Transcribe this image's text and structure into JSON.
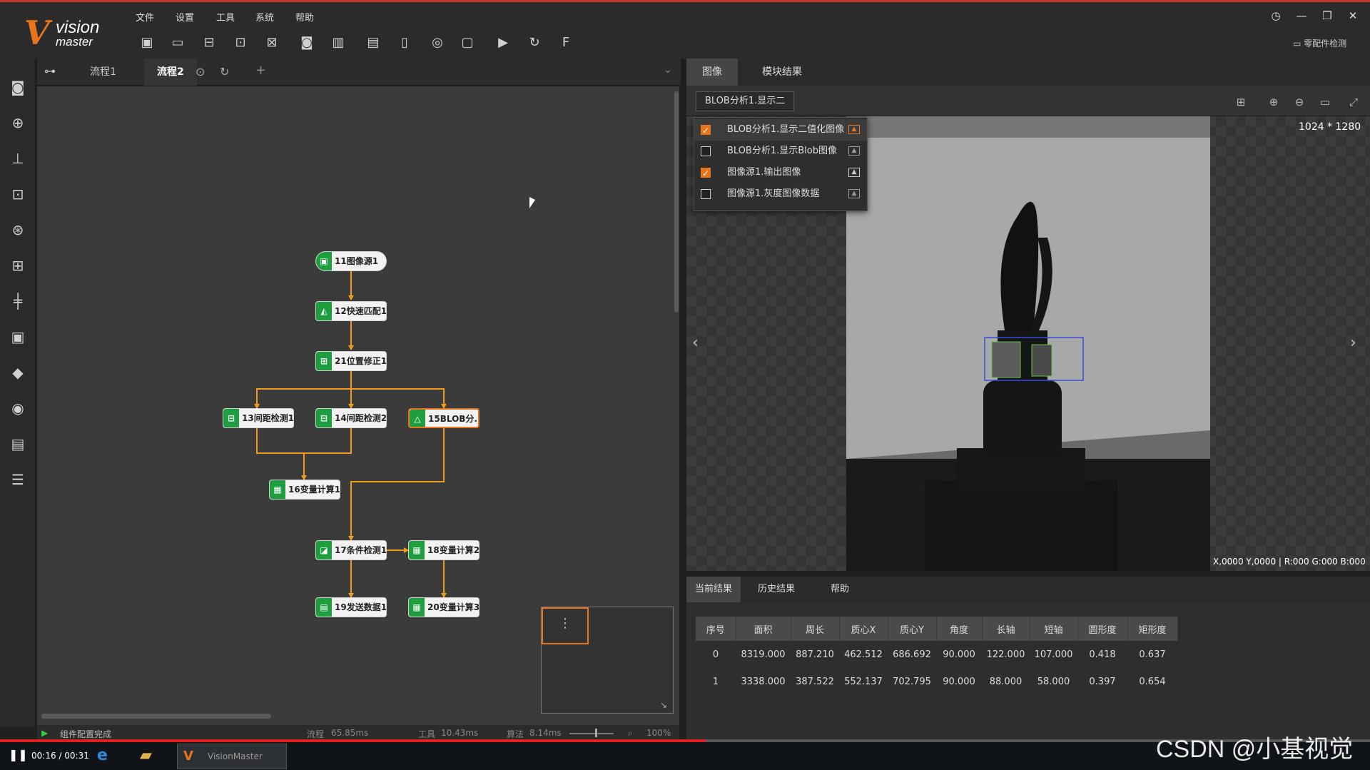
{
  "app": {
    "logo_mark": "V",
    "logo_line1": "vision",
    "logo_line2": "master",
    "right_action_label": "零配件检测"
  },
  "menu": [
    "文件",
    "设置",
    "工具",
    "系统",
    "帮助"
  ],
  "flow_tabs": [
    "流程1",
    "流程2"
  ],
  "nodes": {
    "n11": "11图像源1",
    "n12": "12快速匹配1",
    "n21": "21位置修正1",
    "n13": "13间距检测1",
    "n14": "14间距检测2",
    "n15": "15BLOB分...",
    "n16": "16变量计算1",
    "n17": "17条件检测1",
    "n18": "18变量计算2",
    "n19": "19发送数据1",
    "n20": "20变量计算3"
  },
  "status": {
    "message": "组件配置完成",
    "flow": "流程",
    "flow_time": "65.85ms",
    "tool": "工具",
    "tool_time": "10.43ms",
    "algo": "算法",
    "algo_time": "8.14ms",
    "zoom": "100%"
  },
  "right_tabs": [
    "图像",
    "模块结果"
  ],
  "image_select": "BLOB分析1.显示二",
  "image_options": [
    {
      "label": "BLOB分析1.显示二值化图像",
      "checked": true
    },
    {
      "label": "BLOB分析1.显示Blob图像",
      "checked": false
    },
    {
      "label": "图像源1.输出图像",
      "checked": true
    },
    {
      "label": "图像源1.灰度图像数据",
      "checked": false
    }
  ],
  "image_dims": "1024 * 1280",
  "pixel_info": "X,0000  Y,0000  |  R:000  G:000  B:000",
  "result_tabs": [
    "当前结果",
    "历史结果",
    "帮助"
  ],
  "table": {
    "headers": [
      "序号",
      "面积",
      "周长",
      "质心X",
      "质心Y",
      "角度",
      "长轴",
      "短轴",
      "圆形度",
      "矩形度"
    ],
    "rows": [
      [
        "0",
        "8319.000",
        "887.210",
        "462.512",
        "686.692",
        "90.000",
        "122.000",
        "107.000",
        "0.418",
        "0.637"
      ],
      [
        "1",
        "3338.000",
        "387.522",
        "552.137",
        "702.795",
        "90.000",
        "88.000",
        "58.000",
        "0.397",
        "0.654"
      ]
    ]
  },
  "taskbar": {
    "time_current": "00:16",
    "time_total": "00:31",
    "app_label": "VisionMaster",
    "progress": 0.515
  },
  "watermark": "CSDN @小基视觉"
}
